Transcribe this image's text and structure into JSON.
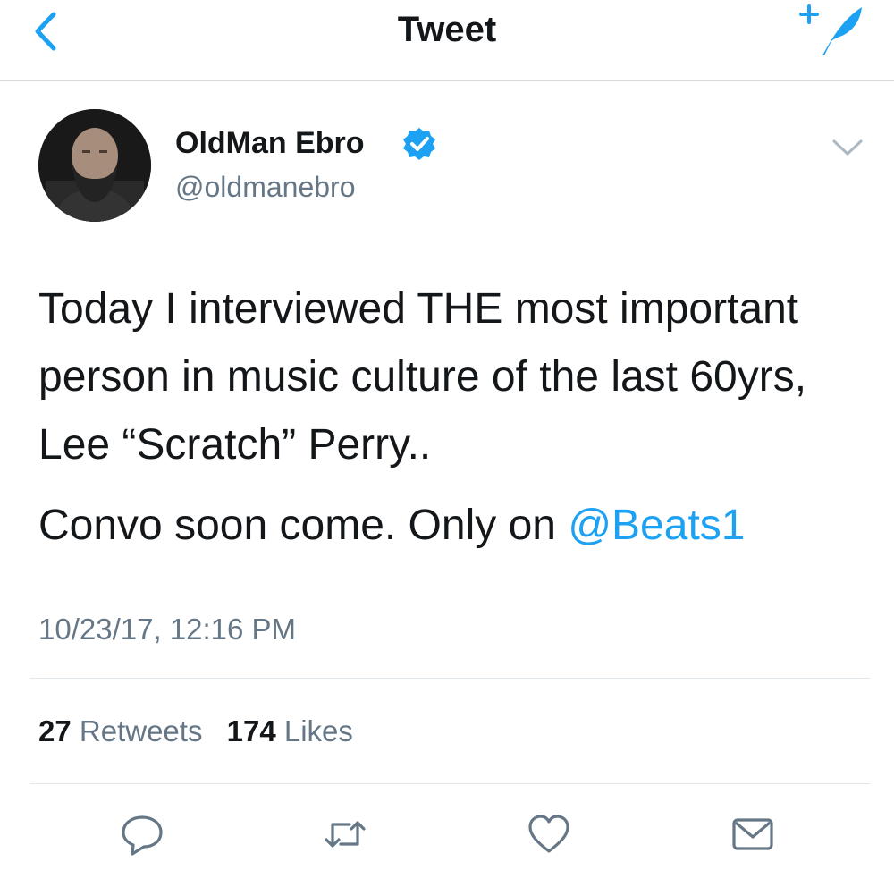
{
  "nav": {
    "title": "Tweet",
    "back_icon": "chevron-left-icon",
    "compose_icon": "compose-tweet-icon"
  },
  "author": {
    "display_name": "OldMan Ebro",
    "handle": "@oldmanebro",
    "verified": true
  },
  "tweet": {
    "paragraph1": "Today I interviewed THE most important person in music culture of the last 60yrs, Lee “Scratch” Perry..",
    "paragraph2_text": "Convo soon come. Only on ",
    "mention": "@Beats1",
    "timestamp": "10/23/17, 12:16 PM"
  },
  "stats": {
    "retweets_count": "27",
    "retweets_label": "Retweets",
    "likes_count": "174",
    "likes_label": "Likes"
  },
  "actions": [
    "reply-icon",
    "retweet-icon",
    "like-icon",
    "direct-message-icon"
  ],
  "colors": {
    "accent": "#1da1f2",
    "text": "#14171a",
    "secondary": "#657786",
    "divider": "#e1e8ed"
  }
}
